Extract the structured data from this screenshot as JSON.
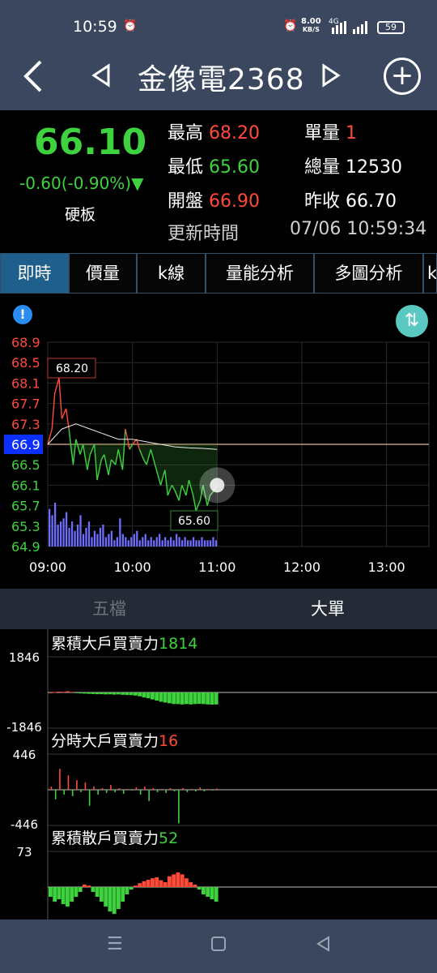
{
  "status_bar": {
    "time": "10:59",
    "speed_value": "8.00",
    "speed_unit": "KB/S",
    "network": "4G",
    "battery": "59",
    "icons": [
      "alarm-icon",
      "signal-icon",
      "wifi-icon"
    ]
  },
  "header": {
    "title": "金像電2368",
    "back_icon": "chevron-left-icon",
    "prev_icon": "triangle-left-icon",
    "next_icon": "triangle-right-icon",
    "add_icon": "plus-circle-icon"
  },
  "quote": {
    "price": "66.10",
    "change": "-0.60(-0.90%)",
    "board": "硬板",
    "high_label": "最高",
    "high": "68.20",
    "low_label": "最低",
    "low": "65.60",
    "open_label": "開盤",
    "open": "66.90",
    "unit_vol_label": "單量",
    "unit_vol": "1",
    "total_vol_label": "總量",
    "total_vol": "12530",
    "prev_close_label": "昨收",
    "prev_close": "66.70",
    "update_label": "更新時間",
    "update_time": "07/06 10:59:34"
  },
  "tabs": [
    "即時",
    "價量",
    "k線",
    "量能分析",
    "多圖分析",
    "k"
  ],
  "active_tab": 0,
  "colors": {
    "up": "#ff4a3a",
    "down": "#3fd23f",
    "accent": "#1e5f8b"
  },
  "chart_data": {
    "type": "line",
    "y_ticks": [
      "68.9",
      "68.5",
      "68.1",
      "67.7",
      "67.3",
      "66.9",
      "66.5",
      "66.1",
      "65.7",
      "65.3",
      "64.9"
    ],
    "ylim": [
      64.9,
      68.9
    ],
    "reference": "66.9",
    "x_ticks": [
      "09:00",
      "10:00",
      "11:00",
      "12:00",
      "13:00"
    ],
    "high_label": "68.20",
    "low_label": "65.60",
    "price_series": {
      "x": [
        "09:00",
        "09:03",
        "09:05",
        "09:08",
        "09:10",
        "09:13",
        "09:15",
        "09:18",
        "09:20",
        "09:23",
        "09:25",
        "09:28",
        "09:30",
        "09:33",
        "09:35",
        "09:38",
        "09:40",
        "09:43",
        "09:45",
        "09:48",
        "09:50",
        "09:53",
        "09:55",
        "09:58",
        "10:00",
        "10:03",
        "10:05",
        "10:08",
        "10:10",
        "10:13",
        "10:15",
        "10:18",
        "10:20",
        "10:23",
        "10:25",
        "10:28",
        "10:30",
        "10:33",
        "10:35",
        "10:38",
        "10:40",
        "10:43",
        "10:45",
        "10:48",
        "10:50",
        "10:53",
        "10:55",
        "10:58",
        "11:00"
      ],
      "y": [
        66.9,
        67.2,
        67.9,
        68.2,
        67.4,
        67.6,
        67.2,
        66.5,
        67.0,
        66.7,
        66.9,
        66.4,
        66.7,
        66.9,
        66.2,
        66.6,
        66.7,
        66.3,
        66.6,
        66.5,
        66.8,
        66.4,
        67.2,
        66.8,
        66.9,
        67.0,
        66.8,
        66.6,
        66.5,
        66.8,
        66.6,
        66.3,
        66.1,
        66.4,
        65.9,
        66.1,
        66.0,
        65.8,
        66.1,
        65.9,
        66.2,
        65.9,
        65.6,
        65.8,
        66.1,
        65.7,
        65.9,
        66.0,
        66.1
      ]
    },
    "average_series": {
      "x": [
        "09:00",
        "09:10",
        "09:20",
        "09:30",
        "09:40",
        "09:50",
        "10:00",
        "10:10",
        "10:20",
        "10:30",
        "10:40",
        "10:50",
        "11:00"
      ],
      "y": [
        66.9,
        67.2,
        67.3,
        67.2,
        67.1,
        67.0,
        67.0,
        66.95,
        66.9,
        66.85,
        66.83,
        66.82,
        66.8
      ]
    },
    "volume_bars": [
      12,
      10,
      14,
      7,
      8,
      9,
      11,
      6,
      8,
      5,
      7,
      10,
      4,
      6,
      8,
      3,
      5,
      4,
      6,
      7,
      3,
      4,
      5,
      2,
      3,
      9,
      4,
      3,
      2,
      3,
      4,
      5,
      2,
      3,
      4,
      2,
      3,
      2,
      3,
      4,
      2,
      3,
      2,
      3,
      2,
      4,
      3,
      2,
      3,
      2,
      2,
      3,
      2,
      2,
      3,
      2,
      2,
      2,
      3,
      2
    ],
    "volume_ylim": [
      0,
      14
    ]
  },
  "subtabs": {
    "left": "五檔",
    "right": "大單",
    "active": "right"
  },
  "flow_panels": [
    {
      "title": "累積大戶買賣力",
      "value": "1814",
      "value_color": "green",
      "top_label": "1846",
      "bottom_label": "-1846"
    },
    {
      "title": "分時大戶買賣力",
      "value": "16",
      "value_color": "red",
      "top_label": "446",
      "bottom_label": "-446"
    },
    {
      "title": "累積散戶買賣力",
      "value": "52",
      "value_color": "green",
      "top_label": "73",
      "bottom_label": "-73"
    }
  ],
  "flow_series": {
    "cumulative_big": [
      0,
      20,
      40,
      30,
      60,
      30,
      -20,
      -50,
      -60,
      -70,
      -80,
      -90,
      -90,
      -100,
      -95,
      -110,
      -100,
      -120,
      -130,
      -140,
      -160,
      -200,
      -260,
      -300,
      -360,
      -420,
      -480,
      -520,
      -560,
      -600,
      -600,
      -620,
      -600,
      -620,
      -600,
      -590,
      -600,
      -620,
      -630,
      -620
    ],
    "cumulative_big_lim": 1846,
    "minute_big": [
      40,
      -120,
      260,
      -60,
      180,
      -80,
      120,
      -30,
      90,
      -200,
      40,
      -60,
      20,
      -40,
      60,
      -30,
      20,
      -50,
      10,
      -10,
      30,
      -60,
      40,
      -140,
      20,
      -30,
      10,
      -40,
      20,
      -20,
      -420,
      20,
      -30,
      10,
      -20,
      30,
      -20,
      10,
      -10,
      16
    ],
    "minute_big_lim": 446,
    "cumulative_retail": [
      -20,
      -30,
      -25,
      -35,
      -40,
      -30,
      -20,
      -10,
      5,
      3,
      -10,
      -20,
      -30,
      -40,
      -50,
      -55,
      -45,
      -30,
      -15,
      -5,
      3,
      8,
      12,
      15,
      18,
      20,
      14,
      10,
      22,
      26,
      30,
      26,
      18,
      10,
      5,
      -5,
      -15,
      -20,
      -25,
      -30
    ],
    "cumulative_retail_lim": 73
  },
  "navbar": [
    "menu-icon",
    "home-icon",
    "back-icon"
  ]
}
